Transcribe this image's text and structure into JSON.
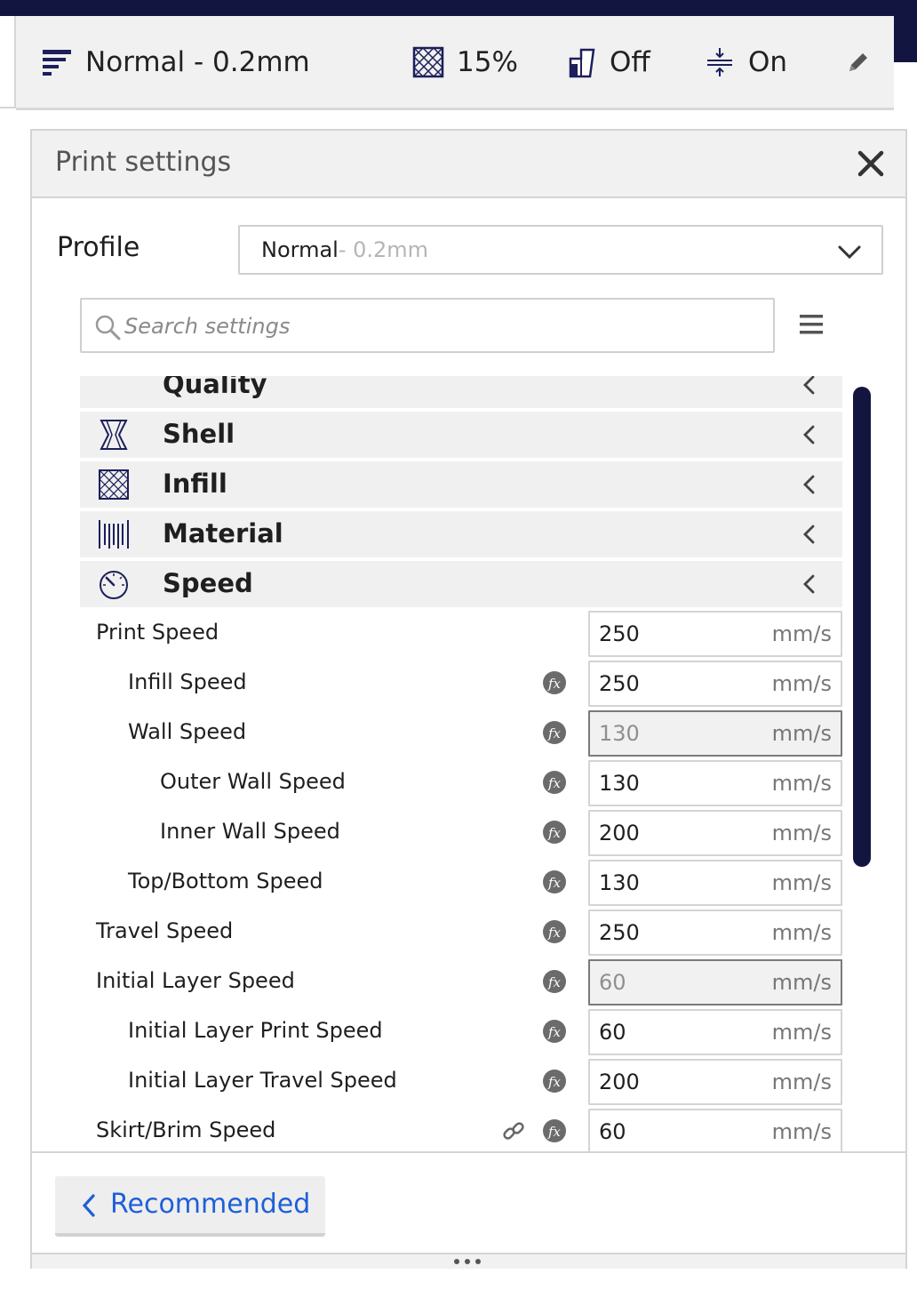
{
  "header": {
    "profile_text": "Normal - 0.2mm",
    "infill_text": "15%",
    "support_text": "Off",
    "adhesion_text": "On"
  },
  "panel": {
    "title": "Print settings",
    "profile_label": "Profile",
    "profile_name": "Normal",
    "profile_sub": " - 0.2mm",
    "search_placeholder": "Search settings"
  },
  "categories": [
    {
      "label": "Quality",
      "icon": "quality-icon"
    },
    {
      "label": "Shell",
      "icon": "shell-icon"
    },
    {
      "label": "Infill",
      "icon": "infill-icon"
    },
    {
      "label": "Material",
      "icon": "material-icon"
    },
    {
      "label": "Speed",
      "icon": "speed-icon"
    }
  ],
  "settings": [
    {
      "label": "Print Speed",
      "value": "250",
      "unit": "mm/s"
    },
    {
      "label": "Infill Speed",
      "value": "250",
      "unit": "mm/s"
    },
    {
      "label": "Wall Speed",
      "value": "130",
      "unit": "mm/s"
    },
    {
      "label": "Outer Wall Speed",
      "value": "130",
      "unit": "mm/s"
    },
    {
      "label": "Inner Wall Speed",
      "value": "200",
      "unit": "mm/s"
    },
    {
      "label": "Top/Bottom Speed",
      "value": "130",
      "unit": "mm/s"
    },
    {
      "label": "Travel Speed",
      "value": "250",
      "unit": "mm/s"
    },
    {
      "label": "Initial Layer Speed",
      "value": "60",
      "unit": "mm/s"
    },
    {
      "label": "Initial Layer Print Speed",
      "value": "60",
      "unit": "mm/s"
    },
    {
      "label": "Initial Layer Travel Speed",
      "value": "200",
      "unit": "mm/s"
    },
    {
      "label": "Skirt/Brim Speed",
      "value": "60",
      "unit": "mm/s"
    }
  ],
  "footer": {
    "recommended_label": "Recommended"
  },
  "colors": {
    "accent": "#1e5fd8",
    "dark": "#131541"
  }
}
